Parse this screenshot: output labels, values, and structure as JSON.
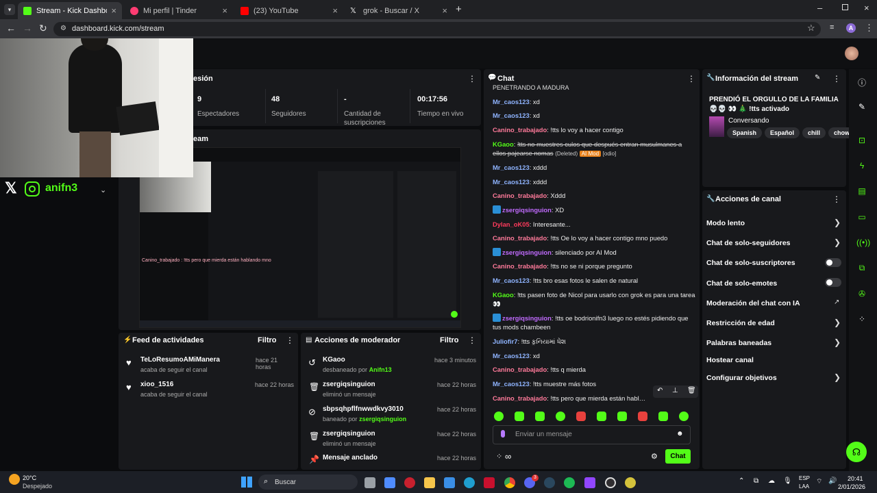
{
  "browser": {
    "tabs": [
      {
        "title": "Stream - Kick Dashboard",
        "color": "#53fc18"
      },
      {
        "title": "Mi perfil | Tinder",
        "color": "#fe3c72"
      },
      {
        "title": "(23) YouTube",
        "color": "#ff0000"
      },
      {
        "title": "grok - Buscar / X",
        "color": "#ffffff"
      }
    ],
    "url": "dashboard.kick.com/stream",
    "profile_initial": "A"
  },
  "overlay": {
    "handle": "anifn3"
  },
  "session": {
    "title": "esión",
    "stats": [
      {
        "value": "9",
        "label": "Espectadores"
      },
      {
        "value": "48",
        "label": "Seguidores"
      },
      {
        "value": "-",
        "label": "Cantidad de suscripciones"
      },
      {
        "value": "00:17:56",
        "label": "Tiempo en vivo"
      }
    ]
  },
  "stream_preview": {
    "label": "eam",
    "chat_overlay": "Canino_trabajado : !tts pero que mierda están hablando mno"
  },
  "activity_feed": {
    "title": "Feed de actividades",
    "filter": "Filtro",
    "items": [
      {
        "name": "TeLoResumoAMiManera",
        "desc": "acaba de seguir el canal",
        "time": "hace 21 horas"
      },
      {
        "name": "xioo_1516",
        "desc": "acaba de seguir el canal",
        "time": "hace 22 horas"
      }
    ]
  },
  "mod_actions": {
    "title": "Acciones de moderador",
    "filter": "Filtro",
    "items": [
      {
        "name": "KGaoo",
        "desc": "desbaneado por",
        "by": "Anifn13",
        "time": "hace 3 minutos",
        "icon": "undo-icon"
      },
      {
        "name": "zsergiqsinguion",
        "desc": "eliminó un mensaje",
        "by": "",
        "time": "hace 22 horas",
        "icon": "trash-icon"
      },
      {
        "name": "sbpsqhpflfnwwdkvy3010",
        "desc": "baneado por",
        "by": "zsergiqsinguion",
        "time": "hace 22 horas",
        "icon": "ban-icon"
      },
      {
        "name": "zsergiqsinguion",
        "desc": "eliminó un mensaje",
        "by": "",
        "time": "hace 22 horas",
        "icon": "trash-icon"
      },
      {
        "name": "Mensaje anclado",
        "desc": "",
        "by": "",
        "time": "hace 22 horas",
        "icon": "pin-icon"
      }
    ]
  },
  "chat": {
    "title": "Chat",
    "top_partial": "PENETRANDO A MADURA",
    "messages": [
      {
        "user": "Mr_caos123",
        "color": "#8fb4ff",
        "text": "xd"
      },
      {
        "user": "Mr_caos123",
        "color": "#8fb4ff",
        "text": "xd"
      },
      {
        "user": "Canino_trabajado",
        "color": "#ff7a9a",
        "text": "!tts lo voy a hacer contigo"
      },
      {
        "user": "KGaoo",
        "color": "#53fc18",
        "text": "!tts no muestres culos que después entran musulmanes a ellos pajearse nomas",
        "deleted": "(Deleted)",
        "tag": "AI Mod",
        "extra": "[odio]"
      },
      {
        "user": "Mr_caos123",
        "color": "#8fb4ff",
        "text": "xddd"
      },
      {
        "user": "Mr_caos123",
        "color": "#8fb4ff",
        "text": "xddd"
      },
      {
        "user": "Canino_trabajado",
        "color": "#ff7a9a",
        "text": "Xddd"
      },
      {
        "user": "zsergiqsinguion",
        "color": "#c16bff",
        "text": "XD",
        "badge": true
      },
      {
        "user": "Dylan_oK05",
        "color": "#ff3b5c",
        "text": "Interesante..."
      },
      {
        "user": "Canino_trabajado",
        "color": "#ff7a9a",
        "text": "!tts Oe lo voy a hacer contigo mno puedo"
      },
      {
        "user": "zsergiqsinguion",
        "color": "#c16bff",
        "text": "silenciado por AI Mod",
        "badge": true
      },
      {
        "user": "Canino_trabajado",
        "color": "#ff7a9a",
        "text": "!tts no se ni porque pregunto"
      },
      {
        "user": "Mr_caos123",
        "color": "#8fb4ff",
        "text": "!tts bro esas fotos le salen de natural"
      },
      {
        "user": "KGaoo",
        "color": "#53fc18",
        "text": "!tts pasen foto de Nicol para usarlo con grok es para una tarea 👀"
      },
      {
        "user": "zsergiqsinguion",
        "color": "#c16bff",
        "text": "!tts oe bodrionifn3 luego no estés pidiendo que tus mods chambeen",
        "badge": true
      },
      {
        "user": "Juliofir7",
        "color": "#8fb4ff",
        "text": "!tts ફ઼નિયામાં ધેશ"
      },
      {
        "user": "Mr_caos123",
        "color": "#8fb4ff",
        "text": "xd"
      },
      {
        "user": "Canino_trabajado",
        "color": "#ff7a9a",
        "text": "!tts q mierda"
      },
      {
        "user": "Mr_caos123",
        "color": "#8fb4ff",
        "text": "!tts muestre más fotos"
      },
      {
        "user": "Canino_trabajado",
        "color": "#ff7a9a",
        "text": "!tts pero que mierda están hablando mno"
      }
    ],
    "input_placeholder": "Enviar un mensaje",
    "send_label": "Chat",
    "infinity": "∞"
  },
  "stream_info": {
    "title": "Información del stream",
    "stream_title": "PRENDIÓ EL ORGULLO DE LA FAMILIA 💀💀 👀 🎄 !tts activado",
    "category": "Conversando",
    "tags": [
      "Spanish",
      "Español",
      "chill",
      "chow"
    ]
  },
  "channel_actions": {
    "title": "Acciones de canal",
    "items": [
      {
        "label": "Modo lento",
        "control": "chevron"
      },
      {
        "label": "Chat de solo-seguidores",
        "control": "chevron"
      },
      {
        "label": "Chat de solo-suscriptores",
        "control": "toggle"
      },
      {
        "label": "Chat de solo-emotes",
        "control": "toggle"
      },
      {
        "label": "Moderación del chat con IA",
        "control": "external"
      },
      {
        "label": "Restricción de edad",
        "control": "chevron"
      },
      {
        "label": "Palabras baneadas",
        "control": "chevron"
      },
      {
        "label": "Hostear canal",
        "control": "none"
      },
      {
        "label": "Configurar objetivos",
        "control": "chevron"
      }
    ]
  },
  "taskbar": {
    "weather_temp": "20°C",
    "weather_desc": "Despejado",
    "search_placeholder": "Buscar",
    "lang_top": "ESP",
    "lang_bottom": "LAA",
    "time": "20:41",
    "date": "2/01/2026",
    "badge_count": "3"
  },
  "colors": {
    "accent": "#53fc18",
    "panel": "#18191c",
    "background": "#0b0c0e"
  }
}
